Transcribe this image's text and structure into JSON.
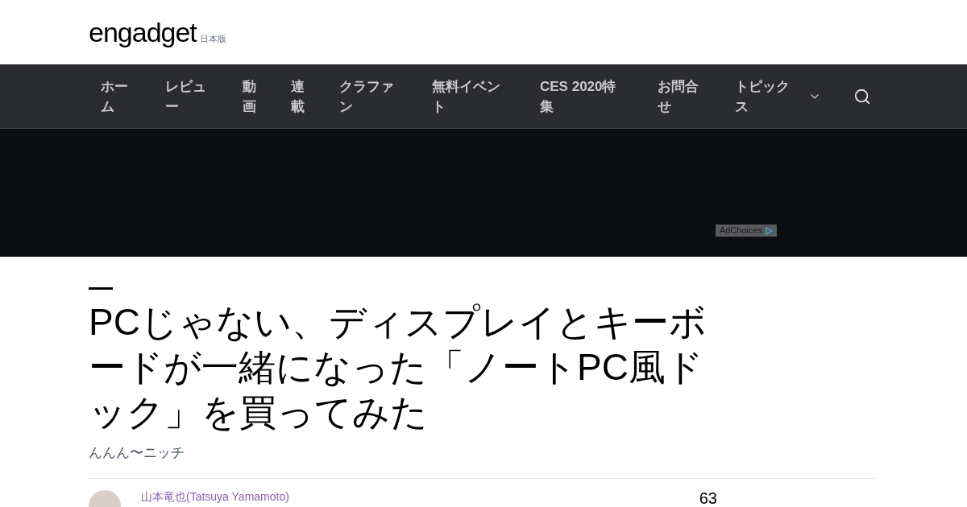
{
  "logo": {
    "text": "engadget",
    "edition": "日本版"
  },
  "nav": {
    "items": [
      {
        "label": "ホーム"
      },
      {
        "label": "レビュー"
      },
      {
        "label": "動画"
      },
      {
        "label": "連載"
      },
      {
        "label": "クラファン"
      },
      {
        "label": "無料イベント"
      },
      {
        "label": "CES 2020特集"
      },
      {
        "label": "お問合せ"
      },
      {
        "label": "トピックス",
        "kind": "dropdown"
      }
    ]
  },
  "ad": {
    "badge": "AdChoices"
  },
  "article": {
    "title": "PCじゃない、ディスプレイとキーボードが一緒になった「ノートPC風ドック」を買ってみた",
    "subtitle": "んんん〜ニッチ",
    "author": "山本竜也(Tatsuya Yamamoto)",
    "count": "63"
  }
}
